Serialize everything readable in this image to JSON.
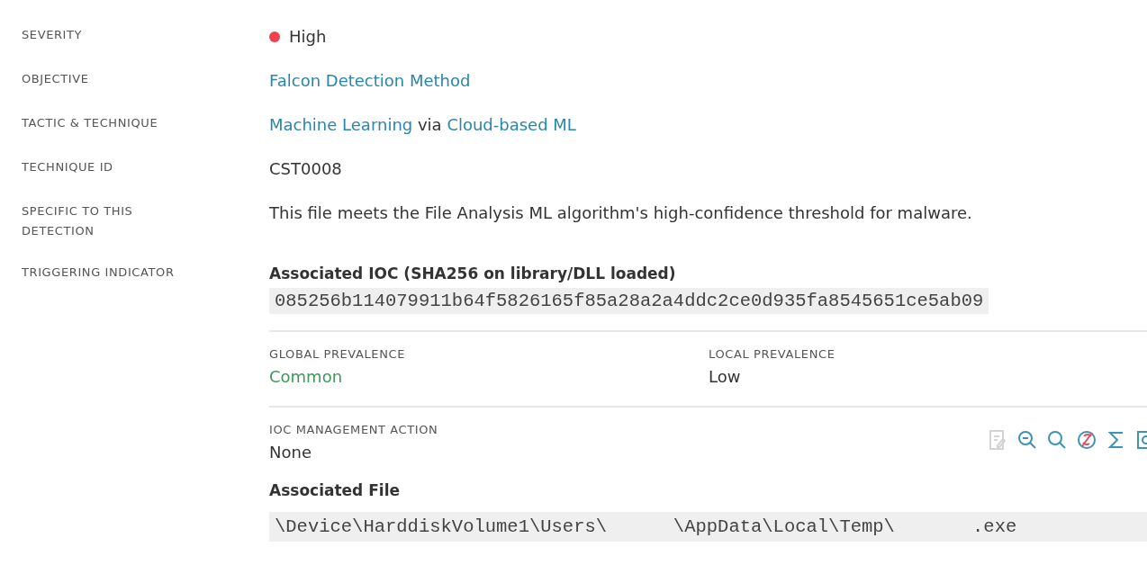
{
  "fields": [
    {
      "kind": "severity",
      "label": "SEVERITY",
      "value": "High",
      "color": "#f2414d"
    },
    {
      "kind": "link",
      "label": "OBJECTIVE",
      "value": "Falcon Detection Method"
    },
    {
      "kind": "parts",
      "label": "TACTIC & TECHNIQUE",
      "parts": [
        {
          "text": "Machine Learning",
          "link": true
        },
        {
          "text": "via",
          "link": false
        },
        {
          "text": "Cloud-based ML",
          "link": true
        }
      ]
    },
    {
      "kind": "text",
      "label": "TECHNIQUE ID",
      "value": "CST0008"
    },
    {
      "kind": "text",
      "label": "SPECIFIC TO THIS DETECTION",
      "value": "This file meets the File Analysis ML algorithm's high-confidence threshold for malware."
    },
    {
      "kind": "indicator",
      "label": "TRIGGERING INDICATOR"
    }
  ],
  "indicator": {
    "ioc_title": "Associated IOC (SHA256 on library/DLL loaded)",
    "hash": "085256b114079911b64f5826165f85a28a2a4ddc2ce0d935fa8545651ce5ab09",
    "prevalence": [
      {
        "label": "GLOBAL PREVALENCE",
        "value": "Common",
        "color": "#3b9a5a"
      },
      {
        "label": "LOCAL PREVALENCE",
        "value": "Low",
        "color": "#333333"
      }
    ],
    "management_label": "IOC MANAGEMENT ACTION",
    "management_value": "None",
    "actions": [
      {
        "kind": "edit",
        "disabled": true
      },
      {
        "kind": "zoom-minus",
        "disabled": false
      },
      {
        "kind": "search",
        "disabled": false
      },
      {
        "kind": "blocked",
        "disabled": false
      },
      {
        "kind": "sum",
        "disabled": false
      },
      {
        "kind": "graph",
        "disabled": false
      }
    ],
    "file_title": "Associated File",
    "file_path": "\\Device\\HarddiskVolume1\\Users\\      \\AppData\\Local\\Temp\\       .exe"
  }
}
